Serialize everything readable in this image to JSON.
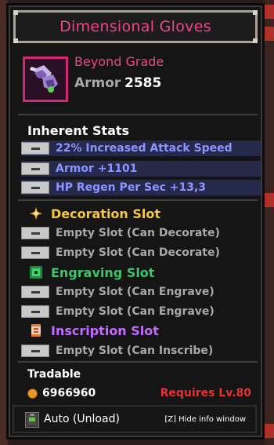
{
  "title": "Dimensional Gloves",
  "item": {
    "grade": "Beyond Grade",
    "armor_label": "Armor",
    "armor_value": "2585",
    "icon": "gloves-icon"
  },
  "inherent": {
    "title": "Inherent Stats",
    "stats": [
      "22% Increased Attack Speed",
      "Armor +1101",
      "HP Regen Per Sec +13,3"
    ]
  },
  "decoration": {
    "title": "Decoration Slot",
    "icon": "decoration-icon",
    "slots": [
      "Empty Slot (Can Decorate)",
      "Empty Slot (Can Decorate)"
    ]
  },
  "engraving": {
    "title": "Engraving Slot",
    "icon": "engraving-icon",
    "slots": [
      "Empty Slot (Can Engrave)",
      "Empty Slot (Can Engrave)"
    ]
  },
  "inscription": {
    "title": "Inscription Slot",
    "icon": "inscription-icon",
    "slots": [
      "Empty Slot (Can Inscribe)"
    ]
  },
  "footer": {
    "tradable": "Tradable",
    "gold": "6966960",
    "requires": "Requires Lv.80",
    "auto_label": "Auto (Unload)",
    "hide_label": "[Z] Hide info window"
  },
  "colors": {
    "title": "#f0458a",
    "blue_stat": "#8a96ff",
    "decoration": "#f5c842",
    "engraving": "#3fc46a",
    "inscription": "#c46bff",
    "requires": "#e83030"
  }
}
